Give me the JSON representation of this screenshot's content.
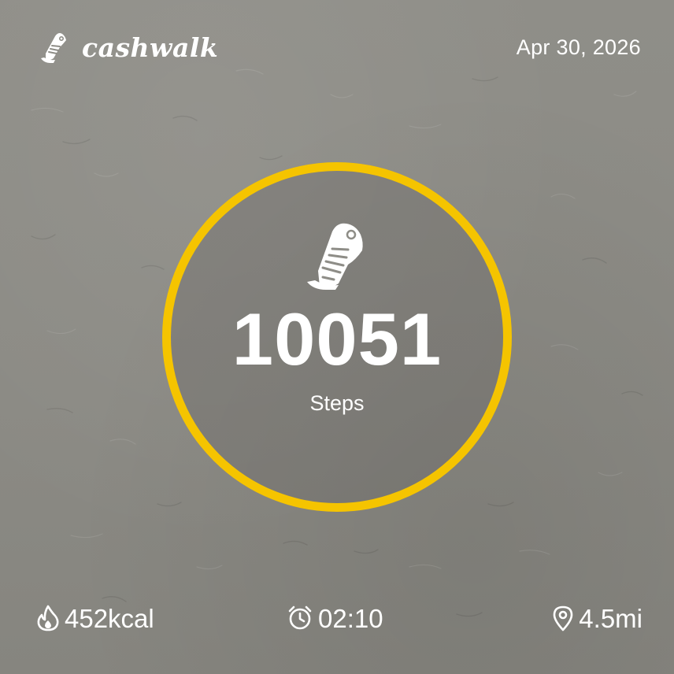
{
  "brand": {
    "name": "cashwalk",
    "icon": "shoe-logo-icon"
  },
  "date": "Apr 30, 2026",
  "steps": {
    "value": "10051",
    "label": "Steps",
    "icon": "shoe-icon"
  },
  "stats": {
    "calories": {
      "value": "452kcal",
      "icon": "flame-icon"
    },
    "time": {
      "value": "02:10",
      "icon": "alarm-clock-icon"
    },
    "distance": {
      "value": "4.5mi",
      "icon": "location-pin-icon"
    }
  },
  "colors": {
    "ring": "#f5c400",
    "background": "#8e8d87",
    "text": "#ffffff"
  }
}
